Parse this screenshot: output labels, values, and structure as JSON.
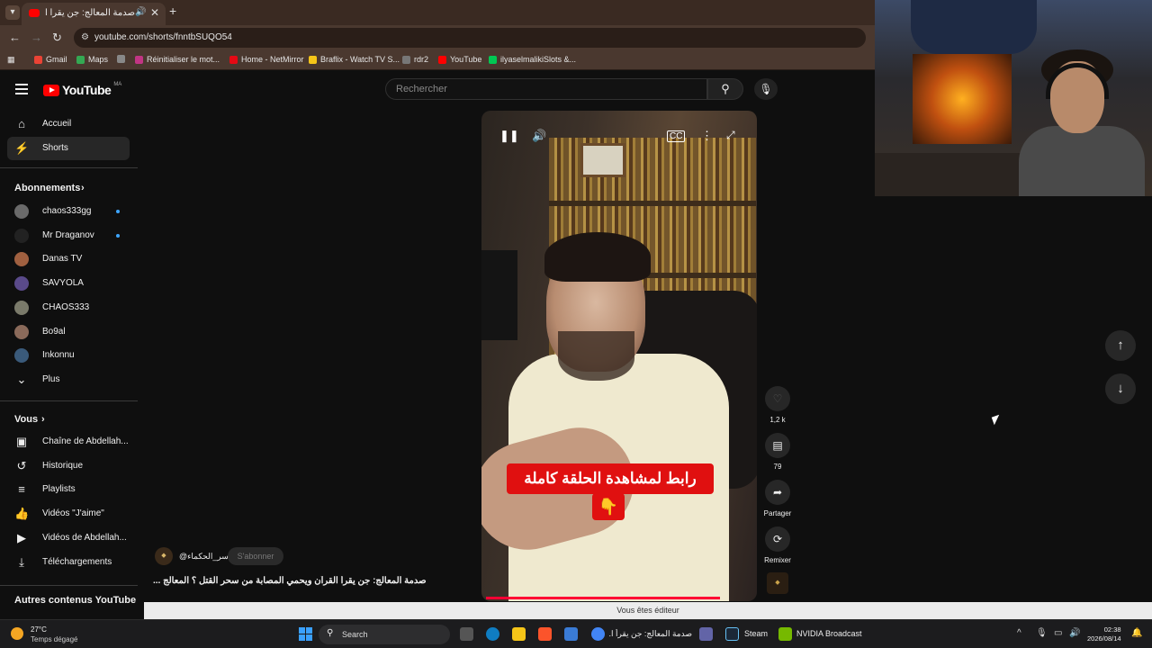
{
  "browser": {
    "tab_title": "صدمة المعالج: جن يقرأ القرآن",
    "url": "youtube.com/shorts/fnntbSUQO54",
    "bookmarks": [
      {
        "label": "Gmail",
        "color": "#ea4335"
      },
      {
        "label": "Maps",
        "color": "#34a853"
      },
      {
        "label": "",
        "color": "#888888"
      },
      {
        "label": "Réinitialiser le mot...",
        "color": "#c13584"
      },
      {
        "label": "Home - NetMirror",
        "color": "#e50914"
      },
      {
        "label": "Braflix - Watch TV S...",
        "color": "#f5c518"
      },
      {
        "label": "rdr2",
        "color": "#777777"
      },
      {
        "label": "YouTube",
        "color": "#ff0000"
      },
      {
        "label": "ilyaselmalikiSlots &...",
        "color": "#00c853"
      }
    ]
  },
  "youtube": {
    "logo_text": "YouTube",
    "region": "MA",
    "search_placeholder": "Rechercher"
  },
  "sidebar": {
    "main": [
      {
        "label": "Accueil",
        "icon": "home-icon",
        "glyph": "⌂"
      },
      {
        "label": "Shorts",
        "icon": "shorts-icon",
        "glyph": "⚡"
      }
    ],
    "subscriptions_heading": "Abonnements",
    "subscriptions": [
      {
        "label": "chaos333gg",
        "avatar": "#6a6a6a",
        "live": true
      },
      {
        "label": "Mr Draganov",
        "avatar": "#222222",
        "live": true
      },
      {
        "label": "Danas TV",
        "avatar": "#a06040",
        "live": false
      },
      {
        "label": "SAVYOLA",
        "avatar": "#5a4a8a",
        "live": false
      },
      {
        "label": "CHAOS333",
        "avatar": "#7a7a6a",
        "live": false
      },
      {
        "label": "Bo9al",
        "avatar": "#8a6a5a",
        "live": false
      },
      {
        "label": "Inkonnu",
        "avatar": "#3a5a7a",
        "live": false
      },
      {
        "label": "Plus",
        "avatar": "",
        "live": false
      }
    ],
    "you_heading": "Vous",
    "you": [
      {
        "label": "Chaîne de Abdellah...",
        "glyph": "▣"
      },
      {
        "label": "Historique",
        "glyph": "↺"
      },
      {
        "label": "Playlists",
        "glyph": "≡"
      },
      {
        "label": "Vidéos \"J'aime\"",
        "glyph": "👍"
      },
      {
        "label": "Vidéos de Abdellah...",
        "glyph": "▶"
      },
      {
        "label": "Téléchargements",
        "glyph": "⤓"
      }
    ],
    "other_heading": "Autres contenus YouTube"
  },
  "short": {
    "caption": "رابط لمشاهدة الحلقة كاملة",
    "caption_emoji": "👇",
    "channel": "@سر_الحكماء",
    "subscribe_label": "S'abonner",
    "title": "صدمة المعالج: جن يقرأ القرآن ويحمي المصابة من سحر القتل ؟ المعالج ...",
    "likes": "1,2 k",
    "comments": "79",
    "share_label": "Partager",
    "remix_label": "Remixer"
  },
  "editor_bar": "Vous êtes éditeur",
  "taskbar": {
    "temperature": "27°C",
    "weather": "Temps dégagé",
    "search_label": "Search",
    "apps": [
      {
        "label": "صدمة المعالج: جن يقرأ ا...",
        "color": "#4285f4"
      },
      {
        "label": "Steam",
        "color": "#1b2838"
      },
      {
        "label": "NVIDIA Broadcast",
        "color": "#76b900"
      }
    ],
    "time": "02:38",
    "date": "2026/08/14"
  }
}
